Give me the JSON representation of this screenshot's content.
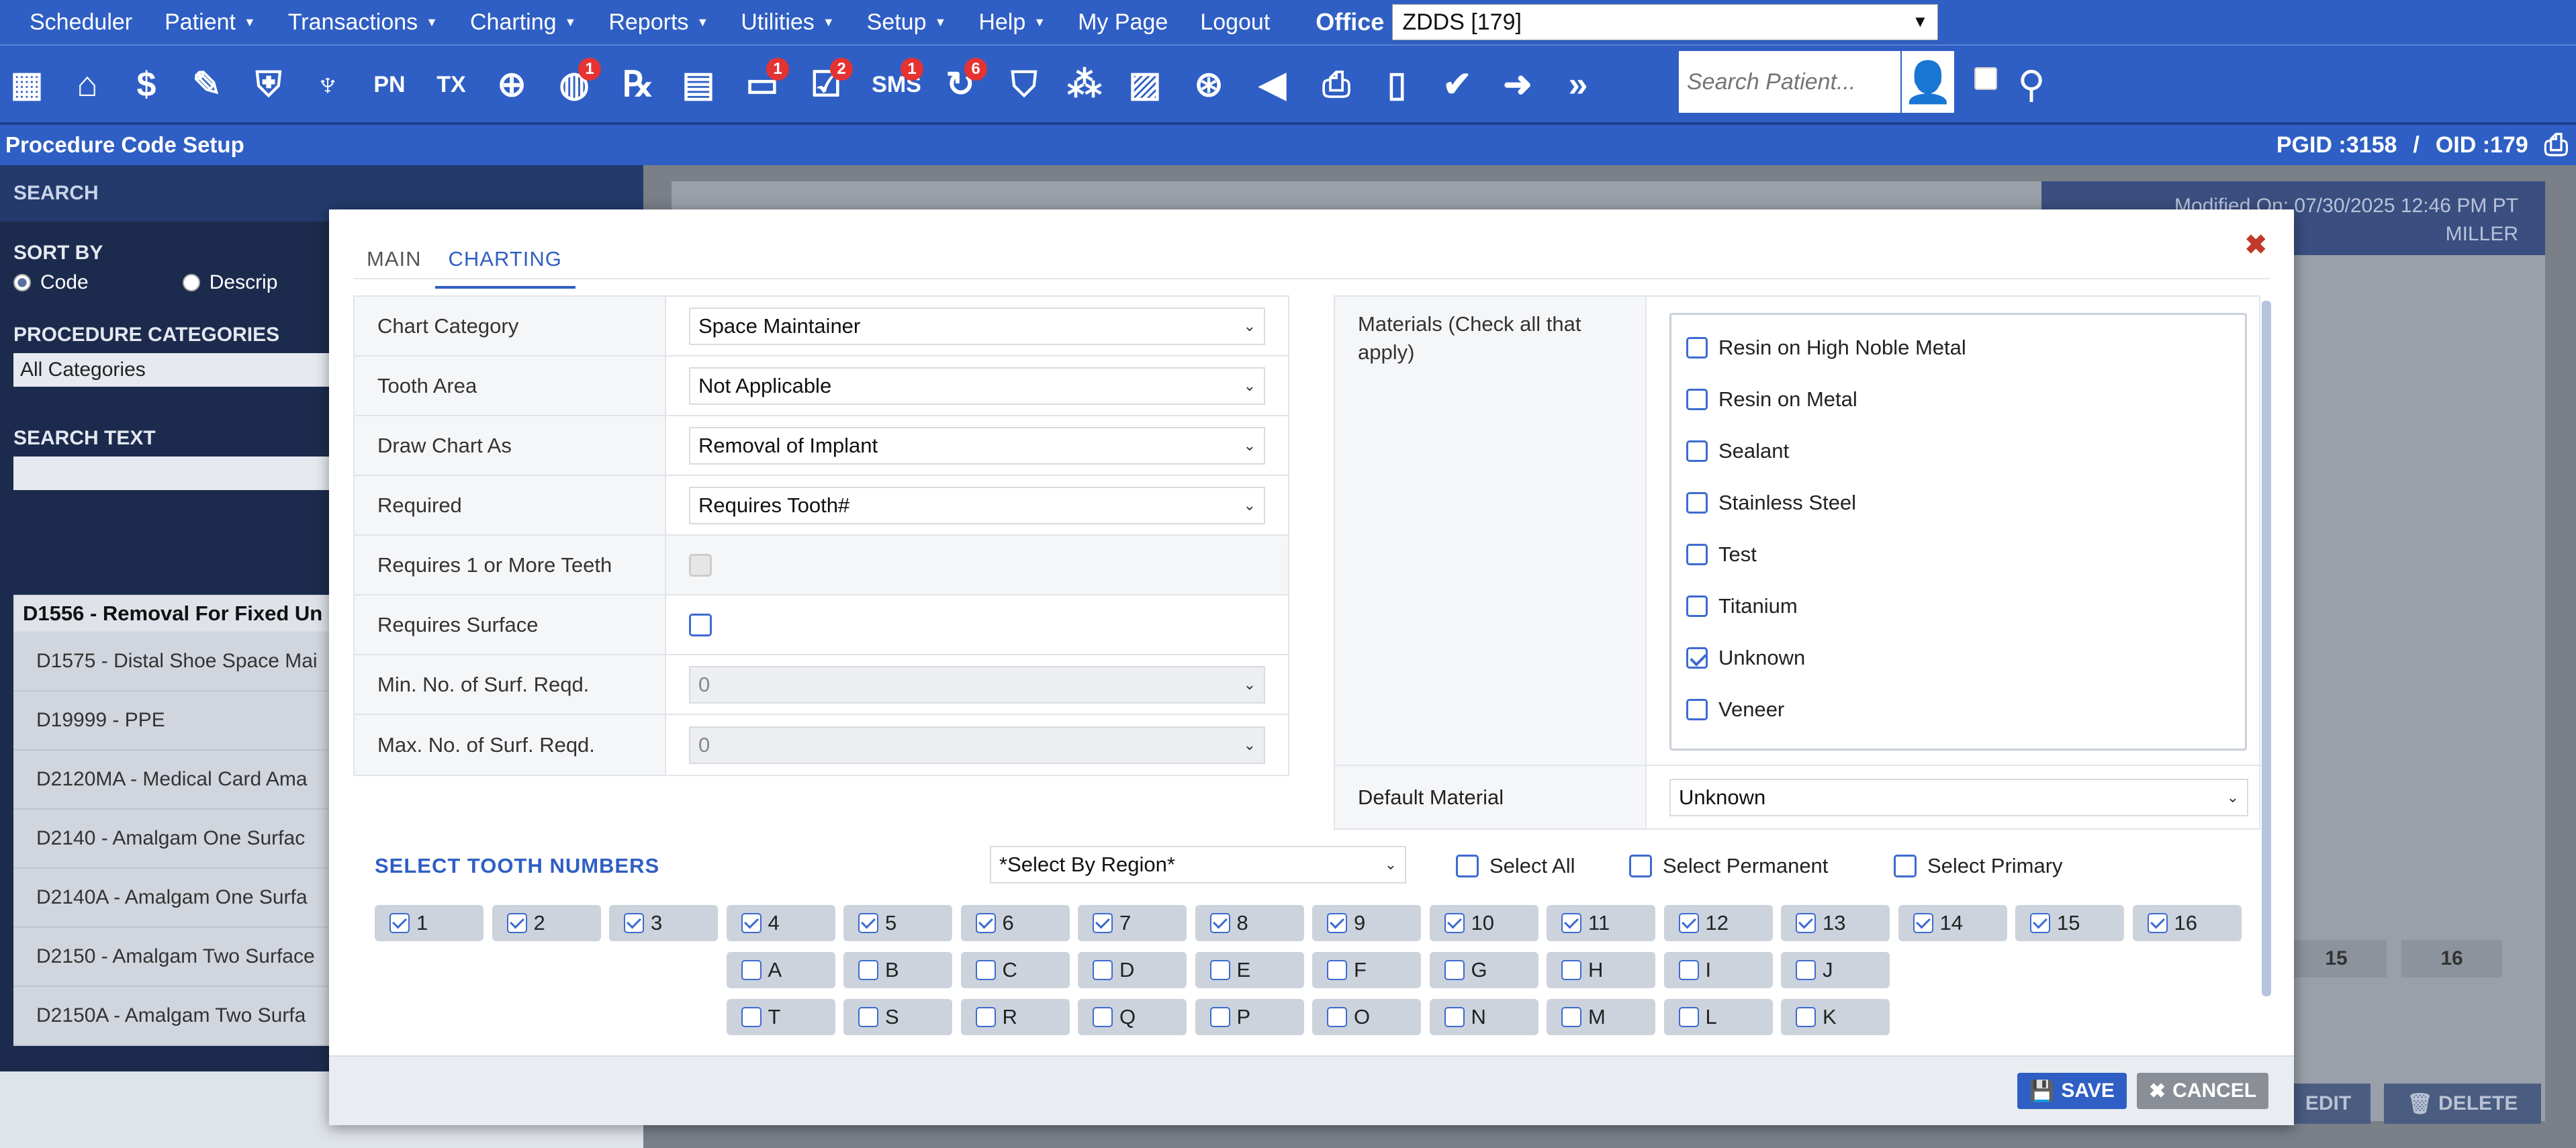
{
  "menu": {
    "items": [
      {
        "label": "Scheduler",
        "caret": false
      },
      {
        "label": "Patient",
        "caret": true
      },
      {
        "label": "Transactions",
        "caret": true
      },
      {
        "label": "Charting",
        "caret": true
      },
      {
        "label": "Reports",
        "caret": true
      },
      {
        "label": "Utilities",
        "caret": true
      },
      {
        "label": "Setup",
        "caret": true
      },
      {
        "label": "Help",
        "caret": true
      },
      {
        "label": "My Page",
        "caret": false
      },
      {
        "label": "Logout",
        "caret": false
      }
    ],
    "office_label": "Office",
    "office_value": "ZDDS [179]"
  },
  "toolbar": {
    "icons": [
      {
        "name": "calendar-icon",
        "glyph": "▦",
        "badge": ""
      },
      {
        "name": "home-icon",
        "glyph": "⌂",
        "badge": ""
      },
      {
        "name": "dollar-icon",
        "glyph": "$",
        "badge": ""
      },
      {
        "name": "edit-list-icon",
        "glyph": "✎",
        "badge": ""
      },
      {
        "name": "tooth-icon",
        "glyph": "⛨",
        "badge": ""
      },
      {
        "name": "implant-icon",
        "glyph": "♆",
        "badge": ""
      },
      {
        "name": "pn-icon",
        "glyph": "PN",
        "badge": ""
      },
      {
        "name": "tx-icon",
        "glyph": "TX",
        "badge": ""
      },
      {
        "name": "add-user-icon",
        "glyph": "⊕",
        "badge": ""
      },
      {
        "name": "globe-user-icon",
        "glyph": "◍",
        "badge": "1"
      },
      {
        "name": "rx-icon",
        "glyph": "℞",
        "badge": ""
      },
      {
        "name": "note-icon",
        "glyph": "▤",
        "badge": ""
      },
      {
        "name": "chat-icon",
        "glyph": "▭",
        "badge": "1"
      },
      {
        "name": "form-icon",
        "glyph": "☑",
        "badge": "2"
      },
      {
        "name": "sms-icon",
        "glyph": "SMS",
        "badge": "1"
      },
      {
        "name": "recall-icon",
        "glyph": "↻",
        "badge": "6"
      },
      {
        "name": "insurance-icon",
        "glyph": "⛉",
        "badge": ""
      },
      {
        "name": "network-icon",
        "glyph": "⁂",
        "badge": ""
      },
      {
        "name": "chart-icon",
        "glyph": "▨",
        "badge": ""
      },
      {
        "name": "world-icon",
        "glyph": "⊛",
        "badge": ""
      },
      {
        "name": "megaphone-icon",
        "glyph": "◀",
        "badge": ""
      },
      {
        "name": "printer-icon",
        "glyph": "⎙",
        "badge": ""
      },
      {
        "name": "document-icon",
        "glyph": "▯",
        "badge": ""
      },
      {
        "name": "shield-check-icon",
        "glyph": "✔",
        "badge": ""
      },
      {
        "name": "shield-arrow-icon",
        "glyph": "➜",
        "badge": ""
      },
      {
        "name": "double-chevron-icon",
        "glyph": "»",
        "badge": ""
      }
    ],
    "search_placeholder": "Search Patient..."
  },
  "header": {
    "title": "Procedure Code Setup",
    "pgid": "PGID :3158",
    "sep": "/",
    "oid": "OID :179"
  },
  "sidebar": {
    "search_label": "SEARCH",
    "sort_by_label": "SORT BY",
    "sort_code": "Code",
    "sort_desc": "Descrip",
    "categories_label": "PROCEDURE CATEGORIES",
    "categories_value": "All Categories",
    "search_text_label": "SEARCH TEXT",
    "rows": [
      "D1556 - Removal For Fixed Un",
      "D1575 - Distal Shoe Space Mai",
      "D19999 - PPE",
      "D2120MA - Medical Card Ama",
      "D2140 - Amalgam One Surfac",
      "D2140A - Amalgam One Surfa",
      "D2150 - Amalgam Two Surface",
      "D2150A - Amalgam Two Surfa"
    ]
  },
  "background": {
    "modified_on": "Modified On: 07/30/2025 12:46 PM PT",
    "modified_by": "MILLER",
    "num_15": "15",
    "num_16": "16",
    "edit_label": "EDIT",
    "delete_label": "DELETE"
  },
  "modal": {
    "tabs": {
      "main": "MAIN",
      "charting": "CHARTING"
    },
    "form": {
      "chart_category_label": "Chart Category",
      "chart_category_value": "Space Maintainer",
      "tooth_area_label": "Tooth Area",
      "tooth_area_value": "Not Applicable",
      "draw_chart_label": "Draw Chart As",
      "draw_chart_value": "Removal of Implant",
      "required_label": "Required",
      "required_value": "Requires Tooth#",
      "req_teeth_label": "Requires 1 or More Teeth",
      "req_surface_label": "Requires Surface",
      "min_surf_label": "Min. No. of Surf. Reqd.",
      "min_surf_value": "0",
      "max_surf_label": "Max. No. of Surf. Reqd.",
      "max_surf_value": "0"
    },
    "materials_label": "Materials (Check all that apply)",
    "materials": [
      {
        "label": "Resin on High Noble Metal",
        "checked": false
      },
      {
        "label": "Resin on Metal",
        "checked": false
      },
      {
        "label": "Sealant",
        "checked": false
      },
      {
        "label": "Stainless Steel",
        "checked": false
      },
      {
        "label": "Test",
        "checked": false
      },
      {
        "label": "Titanium",
        "checked": false
      },
      {
        "label": "Unknown",
        "checked": true
      },
      {
        "label": "Veneer",
        "checked": false
      }
    ],
    "default_material_label": "Default Material",
    "default_material_value": "Unknown",
    "tooth_header": "SELECT TOOTH NUMBERS",
    "region_value": "*Select By Region*",
    "select_all": "Select All",
    "select_permanent": "Select Permanent",
    "select_primary": "Select Primary",
    "teeth_row1": [
      "1",
      "2",
      "3",
      "4",
      "5",
      "6",
      "7",
      "8",
      "9",
      "10",
      "11",
      "12",
      "13",
      "14",
      "15",
      "16"
    ],
    "teeth_row2": [
      "A",
      "B",
      "C",
      "D",
      "E",
      "F",
      "G",
      "H",
      "I",
      "J"
    ],
    "teeth_row3": [
      "T",
      "S",
      "R",
      "Q",
      "P",
      "O",
      "N",
      "M",
      "L",
      "K"
    ],
    "save_label": "SAVE",
    "cancel_label": "CANCEL"
  }
}
